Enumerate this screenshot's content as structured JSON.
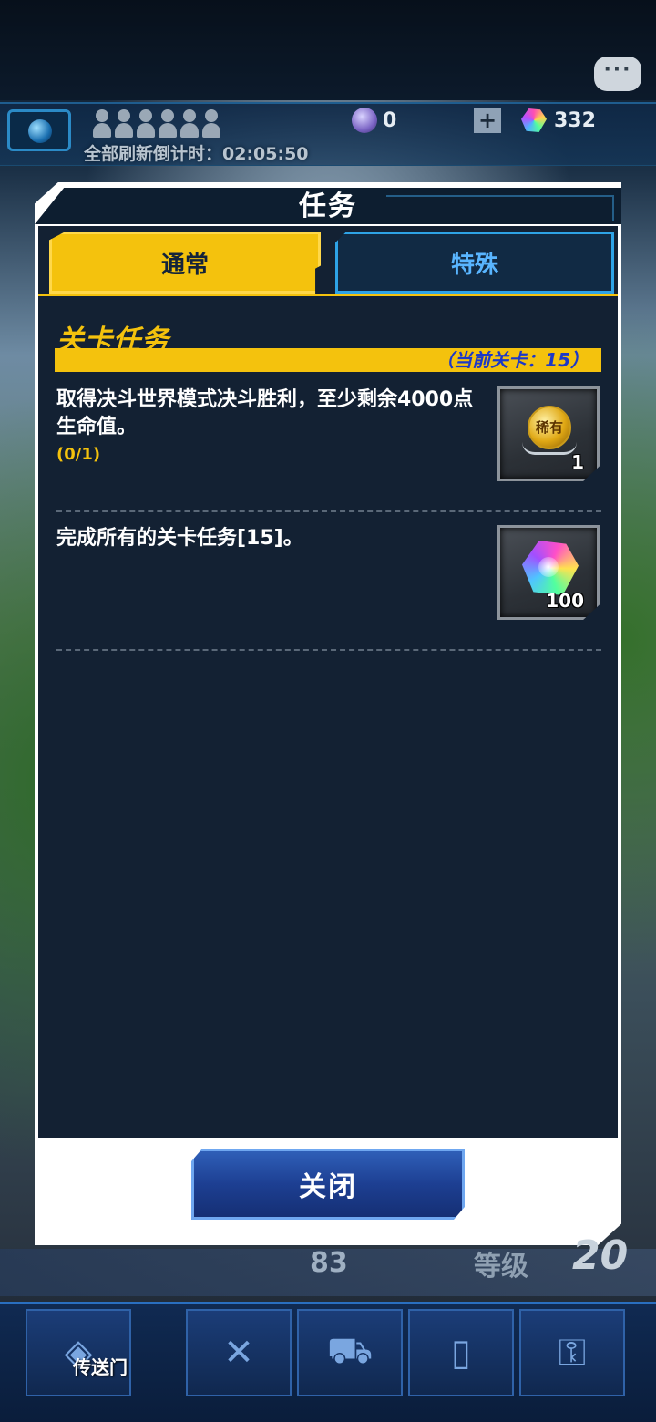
{
  "status": {
    "refresh_countdown": "全部刷新倒计时：02:05:50",
    "coins": "0",
    "gems": "332",
    "chat_icon": "chat-bubble-icon"
  },
  "dialog": {
    "title": "任务",
    "tabs": [
      {
        "label": "通常",
        "selected": true
      },
      {
        "label": "特殊",
        "selected": false
      }
    ],
    "section_heading": "关卡任务",
    "current_stage": "（当前关卡：15）",
    "quests": [
      {
        "text": "取得决斗世界模式决斗胜利，至少剩余4000点生命值。",
        "progress": "(0/1)",
        "reward_icon": "rare-medal-icon",
        "reward_icon_text": "稀有",
        "reward_count": "1"
      },
      {
        "text": "完成所有的关卡任务[15]。",
        "progress": "",
        "reward_icon": "gem-icon",
        "reward_count": "100"
      }
    ],
    "close_label": "关闭"
  },
  "hud": {
    "stat_value": "83",
    "level_label": "等级",
    "level_value": "20"
  },
  "bottom_nav": {
    "gate_label": "传送门",
    "items": [
      "gate-icon",
      "duel-swords-icon",
      "shop-cart-icon",
      "deck-cards-icon",
      "locked-icon"
    ]
  },
  "colors": {
    "accent_yellow": "#f4c20d",
    "special_tab_blue": "#59b5ff",
    "stage_text_blue": "#1c38c8",
    "panel_bg": "#132133"
  }
}
